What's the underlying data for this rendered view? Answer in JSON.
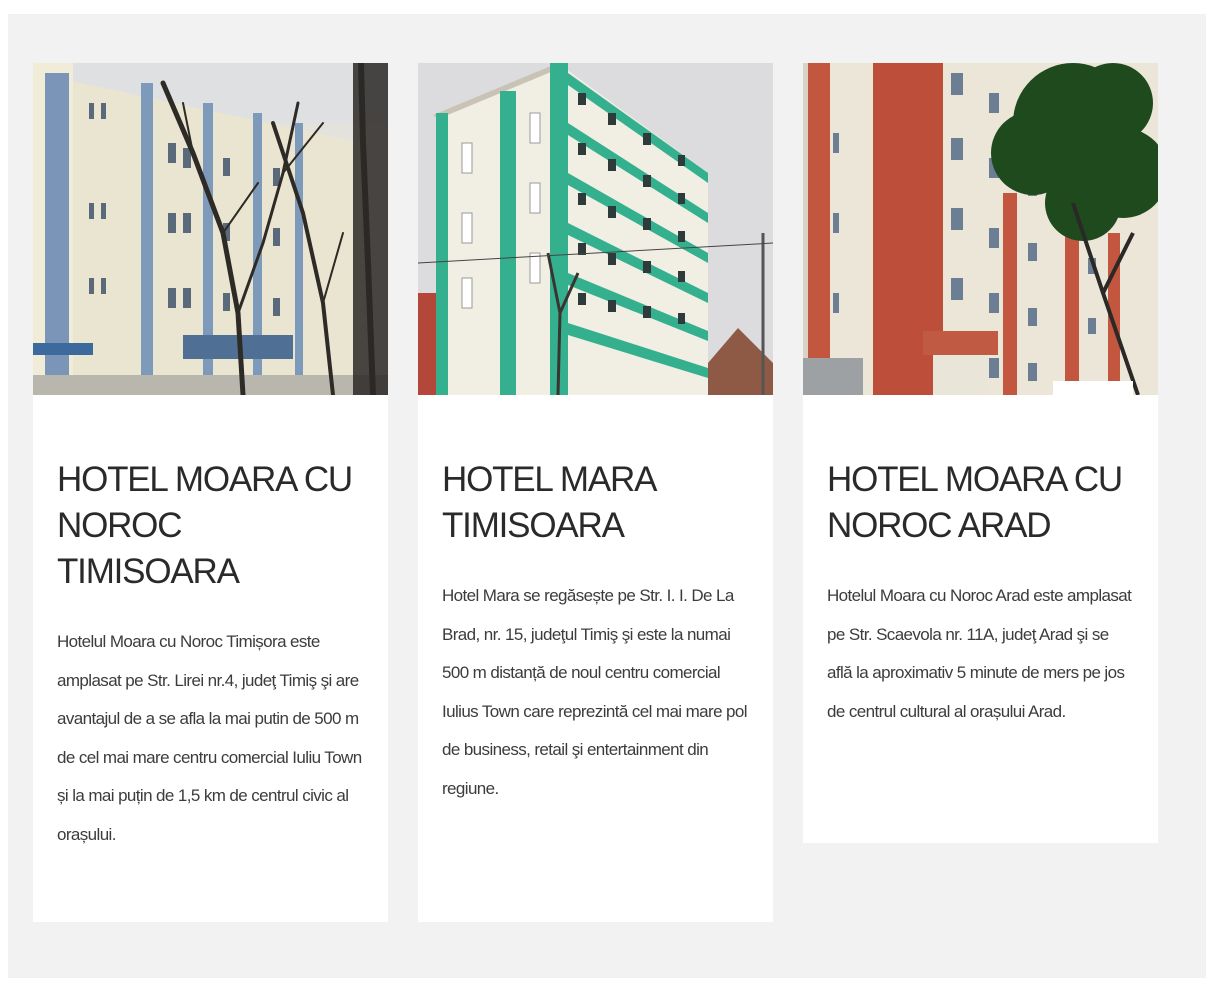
{
  "cards": [
    {
      "image_alt": "Hotel Moara cu Noroc Timisoara building",
      "title_line1": "HOTEL MOARA CU",
      "title_line2": "NOROC TIMISOARA",
      "description": "Hotelul Moara cu Noroc Timișora este amplasat pe Str. Lirei nr.4, judeţ Timiş şi are avantajul de a se afla la mai putin de 500 m de cel mai mare centru comercial Iuliu Town și la mai puțin de 1,5 km de centrul civic al orașului."
    },
    {
      "image_alt": "Hotel Mara Timisoara building",
      "title_line1": "HOTEL MARA",
      "title_line2": "TIMISOARA",
      "description": "Hotel Mara se regăsește pe Str. I. I. De La Brad, nr. 15, judeţul Timiş şi este la numai 500 m distanță de noul centru comercial Iulius Town care reprezintă cel mai mare pol de business, retail şi entertainment din regiune."
    },
    {
      "image_alt": "Hotel Moara cu Noroc Arad building",
      "title_line1": "HOTEL MOARA CU",
      "title_line2": "NOROC ARAD",
      "description": "Hotelul Moara cu Noroc Arad este amplasat pe Str. Scaevola nr. 11A, judeţ Arad şi se află la aproximativ 5 minute de mers pe jos de centrul cultural al orașului Arad."
    }
  ]
}
